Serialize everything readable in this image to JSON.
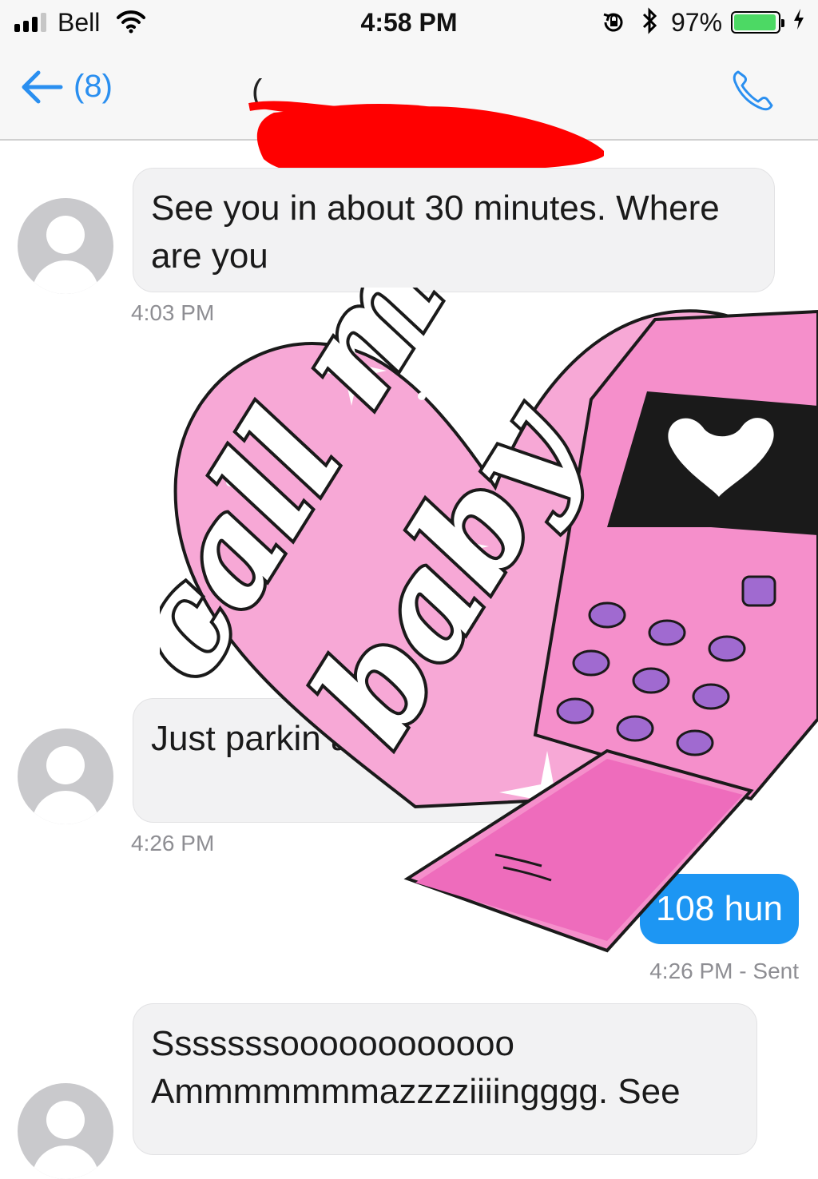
{
  "status_bar": {
    "carrier": "Bell",
    "time": "4:58 PM",
    "battery_percent": "97%",
    "battery_level": 0.97,
    "icons": [
      "signal-icon",
      "wifi-icon",
      "rotation-lock-icon",
      "bluetooth-icon",
      "battery-icon",
      "charging-icon"
    ]
  },
  "nav": {
    "back_count": "(8)",
    "contact_visible": "(",
    "icons": [
      "back-arrow-icon",
      "phone-icon"
    ]
  },
  "messages": [
    {
      "direction": "incoming",
      "text": "See you in about 30 minutes. Where are you",
      "time": "4:03 PM"
    },
    {
      "direction": "incoming",
      "text": "Just parkin are you in.",
      "time": "4:26 PM"
    },
    {
      "direction": "outgoing",
      "text": "108 hun",
      "time": "4:26 PM - Sent"
    },
    {
      "direction": "incoming",
      "text": "Sssssssoooooooooooo Ammmmmmmazzzziiiingggg. See",
      "time": ""
    }
  ],
  "sticker": {
    "text_line1": "call me",
    "text_line2": "baby"
  },
  "colors": {
    "accent_blue": "#2a8ff0",
    "outgoing_bubble": "#1d96f3",
    "incoming_bubble": "#f2f2f3",
    "redaction_red": "#ff0000",
    "sticker_pink": "#f7a8d6"
  }
}
